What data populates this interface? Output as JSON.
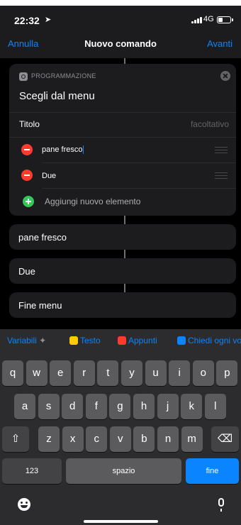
{
  "status_bar": {
    "time": "22:32",
    "location_glyph": "➤",
    "network": "4G"
  },
  "navbar": {
    "cancel": "Annulla",
    "title": "Nuovo comando",
    "next": "Avanti"
  },
  "action_card": {
    "category": "PROGRAMMAZIONE",
    "title": "Scegli dal menu",
    "prompt_label": "Titolo",
    "prompt_placeholder": "facoltativo",
    "items": [
      {
        "label": "pane fresco"
      },
      {
        "label": "Due"
      }
    ],
    "add_item": "Aggiungi nuovo elemento"
  },
  "menu_blocks": [
    {
      "label": "pane fresco"
    },
    {
      "label": "Due"
    },
    {
      "label": "Fine menu"
    }
  ],
  "suggestions": {
    "variables": "Variabili",
    "text": "Testo",
    "clipboard": "Appunti",
    "ask": "Chiedi ogni volta"
  },
  "keyboard": {
    "row1": [
      "q",
      "w",
      "e",
      "r",
      "t",
      "y",
      "u",
      "i",
      "o",
      "p"
    ],
    "row2": [
      "a",
      "s",
      "d",
      "f",
      "g",
      "h",
      "j",
      "k",
      "l"
    ],
    "row3": [
      "z",
      "x",
      "c",
      "v",
      "b",
      "n",
      "m"
    ],
    "shift": "⇧",
    "backspace": "⌫",
    "numbers": "123",
    "space": "spazio",
    "done": "fine"
  },
  "colors": {
    "accent": "#0a84ff",
    "delete": "#ff3b30",
    "add": "#34c759"
  }
}
